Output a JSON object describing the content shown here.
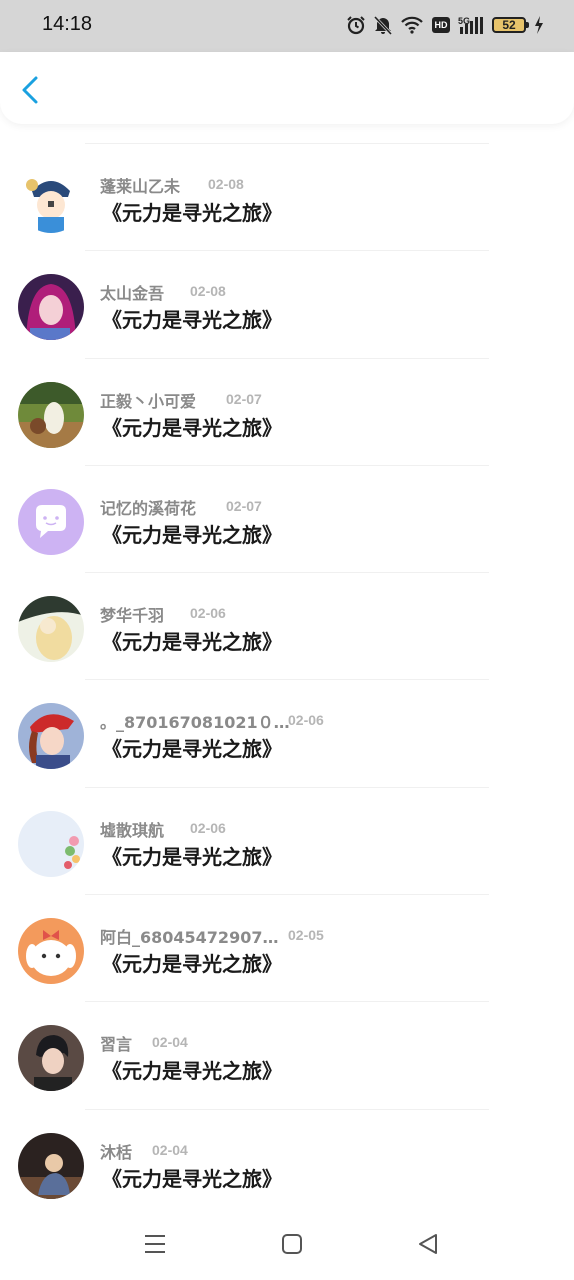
{
  "status": {
    "time": "14:18",
    "battery": "52",
    "network": "5G",
    "hd": "HD"
  },
  "colors": {
    "accent": "#1aa1e0",
    "status_bg": "#d6d6d6",
    "title": "#1a1a1a",
    "username": "#8a8a8a",
    "date": "#b5b5b5"
  },
  "items": [
    {
      "user": "蓬莱山乙未",
      "date": "02-08",
      "title": "《元力是寻光之旅》",
      "avatar": "cartoon-avatar"
    },
    {
      "user": "太山金吾",
      "date": "02-08",
      "title": "《元力是寻光之旅》",
      "avatar": "girl-avatar"
    },
    {
      "user": "正毅丶小可爱",
      "date": "02-07",
      "title": "《元力是寻光之旅》",
      "avatar": "alpaca-avatar"
    },
    {
      "user": "记忆的溪荷花",
      "date": "02-07",
      "title": "《元力是寻光之旅》",
      "avatar": "default-chat-avatar"
    },
    {
      "user": "梦华千羽",
      "date": "02-06",
      "title": "《元力是寻光之旅》",
      "avatar": "anime-avatar"
    },
    {
      "user": "。_870167081021０…",
      "date": "02-06",
      "title": "《元力是寻光之旅》",
      "avatar": "red-hat-avatar"
    },
    {
      "user": "墟散琪航",
      "date": "02-06",
      "title": "《元力是寻光之旅》",
      "avatar": "flower-avatar"
    },
    {
      "user": "阿白_68045472907…",
      "date": "02-05",
      "title": "《元力是寻光之旅》",
      "avatar": "dog-avatar"
    },
    {
      "user": "習言",
      "date": "02-04",
      "title": "《元力是寻光之旅》",
      "avatar": "boy-avatar"
    },
    {
      "user": "沐栝",
      "date": "02-04",
      "title": "《元力是寻光之旅》",
      "avatar": "night-avatar"
    }
  ]
}
